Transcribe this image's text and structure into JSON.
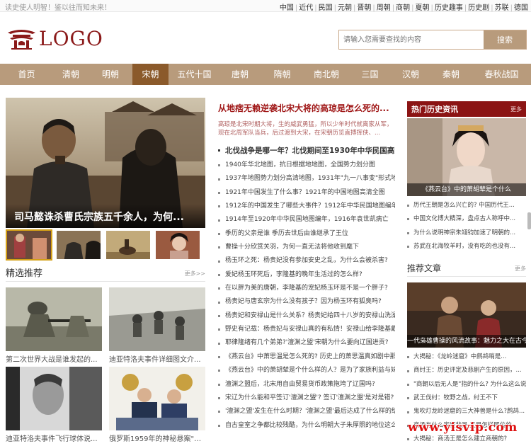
{
  "topbar": {
    "welcome": "读史使人明智！鉴以往而知未来！",
    "dynasties": [
      "中国",
      "近代",
      "民国",
      "元朝",
      "晋朝",
      "周朝",
      "商朝",
      "夏朝",
      "历史趣事",
      "历史剧",
      "苏联",
      "德国"
    ]
  },
  "logo": {
    "text": "LOGO"
  },
  "search": {
    "placeholder": "请输入您需要查找的内容",
    "button": "搜索"
  },
  "nav": {
    "items": [
      "首页",
      "清朝",
      "明朝",
      "宋朝",
      "五代十国",
      "唐朝",
      "隋朝",
      "南北朝",
      "三国",
      "汉朝",
      "秦朝",
      "春秋战国"
    ],
    "active": "宋朝"
  },
  "hero": {
    "caption": "司马懿诛杀曹氏宗族五千余人，为何..."
  },
  "featured": {
    "title": "精选推荐",
    "more": "更多>>",
    "cards": [
      {
        "caption": "第二次世界大战是谁发起的..."
      },
      {
        "caption": "迪亚特洛夫事件详细图文介..."
      },
      {
        "caption": "迪亚特洛夫事件飞行球体说..."
      },
      {
        "caption": "俄罗斯1959年的神秘悬案\"迪..."
      }
    ]
  },
  "main": {
    "headline": "从地痞无赖逆袭北宋大将的高琼是怎么死的...",
    "summary": "高琼是北宋时期大将，生的威武勇猛，所以少年时代就离家从军，现在北周军队当兵，后过渡到大宋，在宋朝历览直搏挥侠、...",
    "sub_headline": "北伐战争是哪一年？北伐期间至1930年中华民国高清...",
    "news": [
      "1940年华北地图，抗日根据地地图，全国势力划分图",
      "1937年地图势力划分高清地图，1931年\"九一八事变\"形式地...",
      "1921年中国发生了什么事？1921年的中国地图高清全图",
      "1912年的中国发生了哪些大事件？1912年中华民国地图编年",
      "1914年至1920年中华民国地图编年，1916年袁世凯病亡",
      "季历的父亲是谁 季历去世后由谁继承了王位",
      "曹操十分欣赏关羽，为何一直无法将他收到麾下",
      "杨玉环之死：杨贵妃没有参加安史之乱，为什么会被杀害?",
      "爱妃杨玉环死后，李隆基的晚年生活过的怎么样?",
      "在以胖为美的唐朝，李隆基的宠妃杨玉环是不是一个胖子?",
      "杨贵妃与唐玄宗为什么没有孩子？因为杨玉环有狐臭吗?",
      "杨贵妃和安禄山是什么关系？杨贵妃给四十八岁的安禄山洗澡...",
      "野史有记载：杨贵妃与安禄山真的有私情！安禄山给李隆基戴...",
      "耶律隆绪有几个弟弟?'澶渊之盟'宋朝为什么要向辽国进贡?",
      "《燕云台》中萧思温是怎么死的? 历史上的萧思温真如剧中那...",
      "《燕云台》中的萧胡辇是个什么样的人？是为了家族利益与妹...",
      "澶渊之盟后，北宋用自由贸易货币政策拖垮了辽国吗?",
      "宋辽为什么能和平签订'澶渊之盟'? 签订'澶渊之盟'是对是错?",
      "'澶渊之盟'发生在什么时期？'澶渊之盟'最后达成了什么样的结局?",
      "自古皇室之争都比较残酷，为什么明朝大子朱厚照的地位这么..."
    ]
  },
  "hot": {
    "title": "热门历史资讯",
    "more": "更多",
    "img_caption": "《燕云台》中的萧胡辇是个什么",
    "items": [
      "历代王朝是怎么兴亡的? 中国历代王...",
      "中国文化博大精深，盘点古人称呼中...",
      "为什么说明神宗朱翊钧加速了明朝的...",
      "苏武在北海牧羊时，没有吃的也没有..."
    ]
  },
  "recommended": {
    "title": "推荐文章",
    "more": "更多",
    "img_caption": "一代枭雄曹操的风流故事：魅力之大在古今",
    "items": [
      "大揭秘：《龙岭迷窟》中鹧鸪哨是...",
      "商纣王：历史评定及悲剧产生的原因，...",
      "\"商朝以后无人是\"指的什么? 为什么这么说",
      "武王伐纣：牧野之战，纣王不下",
      "鬼吹灯龙岭迷窟的三大神兽是什么?鹧鸪...",
      "商汤有什么家庭背景 又是怎样即位的",
      "大揭秘：商汤王是怎么建立商朝的?"
    ]
  },
  "watermark": "www.yisvip.com"
}
